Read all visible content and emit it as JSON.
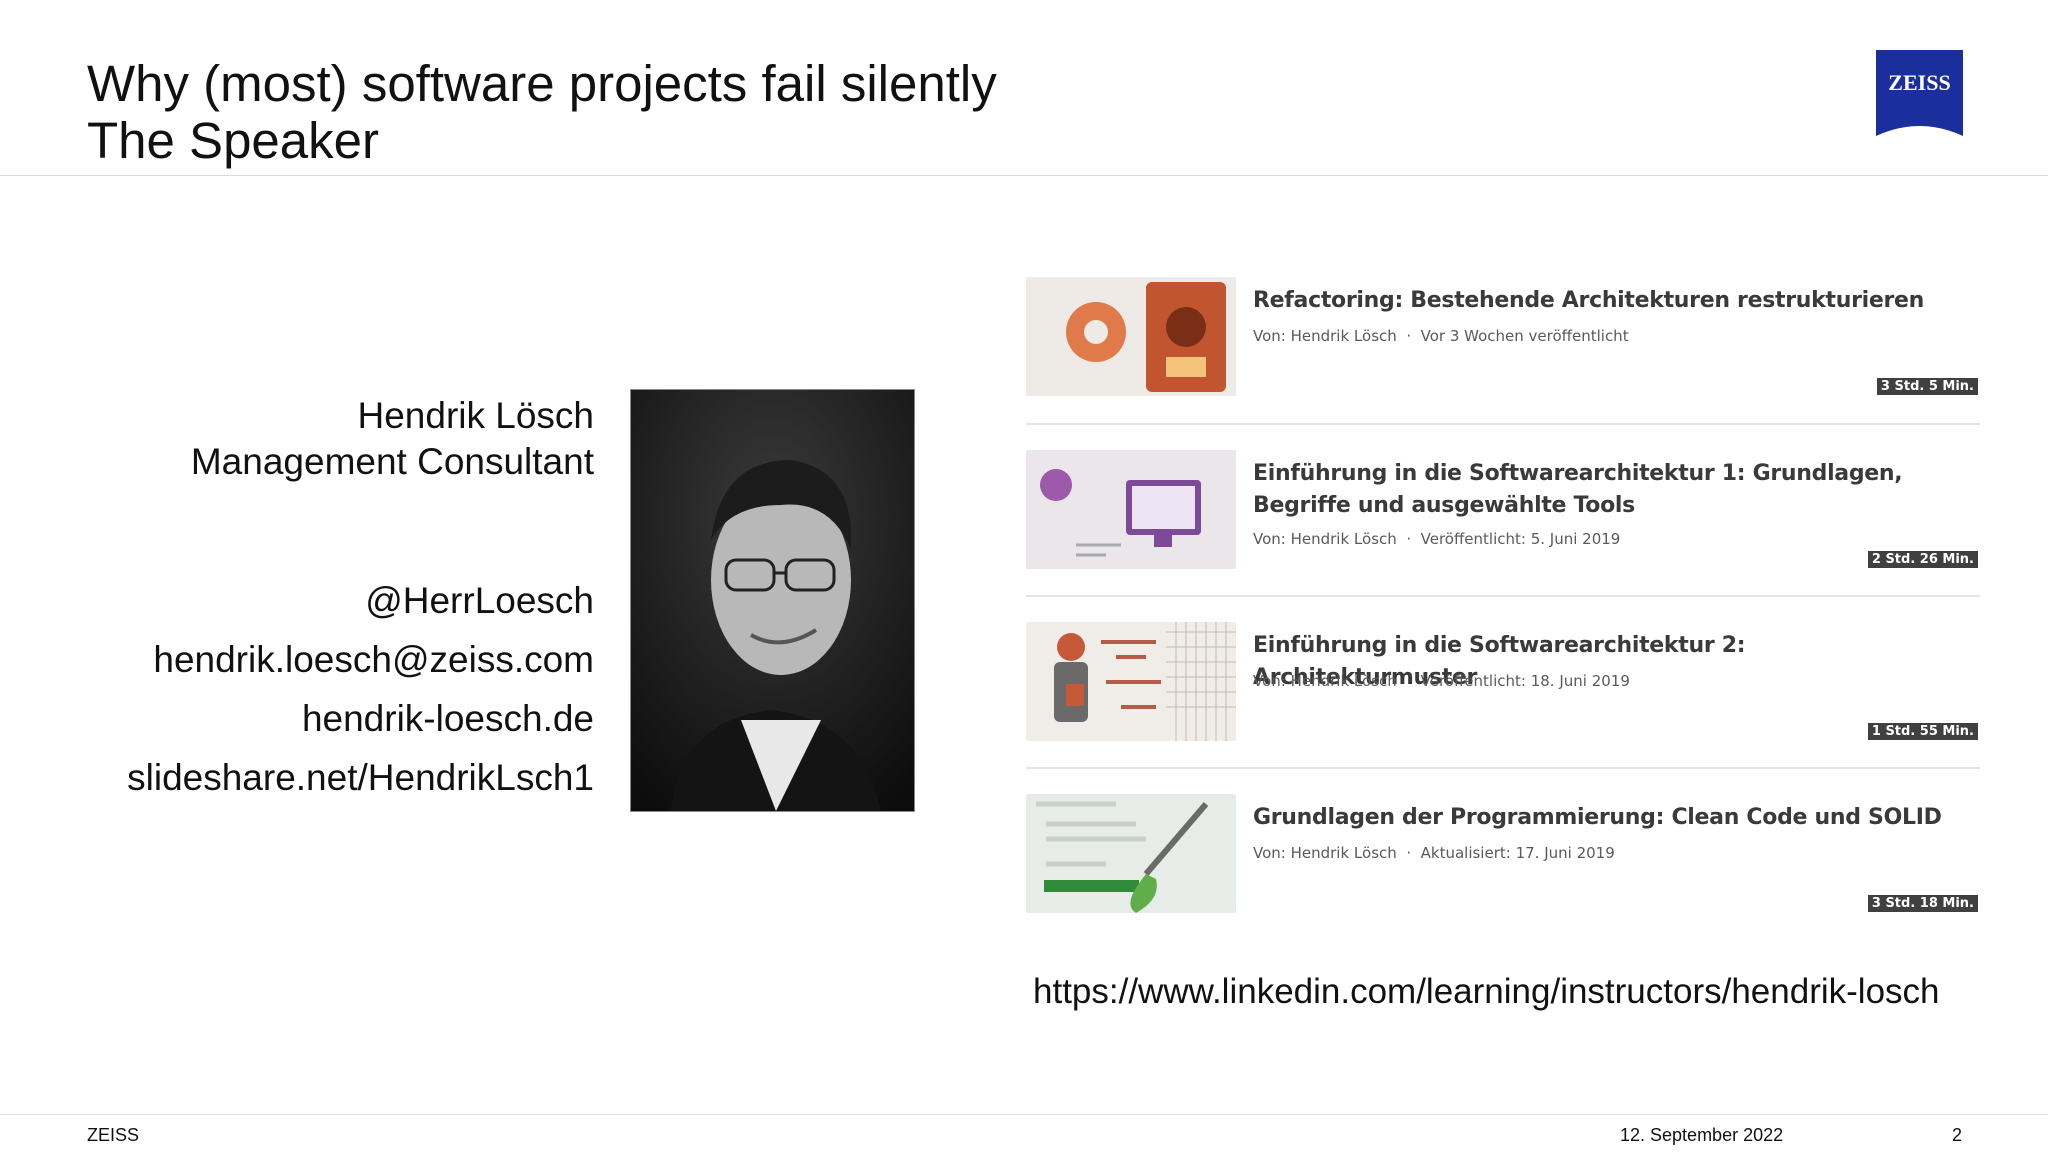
{
  "slide": {
    "title_line1": "Why (most) software projects fail silently",
    "title_line2": "The Speaker",
    "logo_text": "ZEISS",
    "logo_color": "#1a2f9c"
  },
  "speaker": {
    "name": "Hendrik Lösch",
    "role": "Management Consultant",
    "contacts": [
      "@HerrLoesch",
      "hendrik.loesch@zeiss.com",
      "hendrik-loesch.de",
      "slideshare.net/HendrikLsch1"
    ]
  },
  "courses": [
    {
      "title": "Refactoring: Bestehende Architekturen restrukturieren",
      "author": "Von: Hendrik Lösch",
      "date": "Vor 3 Wochen veröffentlicht",
      "duration": "3 Std. 5 Min."
    },
    {
      "title": "Einführung in die Softwarearchitektur 1: Grundlagen, Begriffe und ausgewählte Tools",
      "author": "Von: Hendrik Lösch",
      "date": "Veröffentlicht: 5. Juni 2019",
      "duration": "2 Std. 26 Min."
    },
    {
      "title": "Einführung in die Softwarearchitektur 2: Architekturmuster",
      "author": "Von: Hendrik Lösch",
      "date": "Veröffentlicht: 18. Juni 2019",
      "duration": "1 Std. 55 Min."
    },
    {
      "title": "Grundlagen der Programmierung: Clean Code und SOLID",
      "author": "Von: Hendrik Lösch",
      "date": "Aktualisiert: 17. Juni 2019",
      "duration": "3 Std. 18 Min."
    }
  ],
  "linkedin_url": "https://www.linkedin.com/learning/instructors/hendrik-losch",
  "footer": {
    "brand": "ZEISS",
    "date": "12. September 2022",
    "page": "2"
  }
}
